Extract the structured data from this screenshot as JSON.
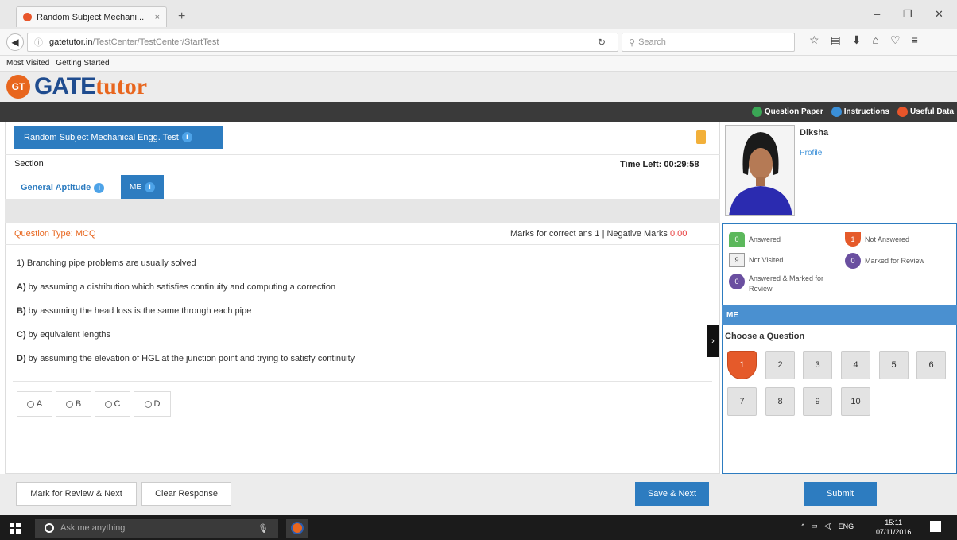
{
  "browser": {
    "tab_title": "Random Subject Mechani...",
    "tab_close": "×",
    "new_tab": "+",
    "win_min": "–",
    "win_max": "❐",
    "win_close": "✕",
    "url_domain": "gatetutor.in",
    "url_path": "/TestCenter/TestCenter/StartTest",
    "search_placeholder": "Search",
    "bookmarks": [
      "Most Visited",
      "Getting Started"
    ]
  },
  "header": {
    "logo_badge": "GT",
    "logo_gate": "GATE",
    "logo_tutor": "tutor",
    "links": [
      {
        "label": "Question Paper",
        "color": "#3aa655"
      },
      {
        "label": "Instructions",
        "color": "#3a8fd8"
      },
      {
        "label": "Useful Data",
        "color": "#e8552a"
      }
    ]
  },
  "test": {
    "title": "Random Subject Mechanical Engg. Test",
    "section_label": "Section",
    "time_left": "Time Left: 00:29:58",
    "tabs": [
      {
        "label": "General Aptitude",
        "active": false
      },
      {
        "label": "ME",
        "active": true
      }
    ]
  },
  "question": {
    "type_label": "Question Type: MCQ",
    "marks_prefix": "Marks for correct ans",
    "marks_correct": "1",
    "marks_sep": "| Negative Marks",
    "marks_negative": "0.00",
    "text": "1) Branching pipe problems are usually solved",
    "options": [
      {
        "key": "A)",
        "text": "by assuming a distribution which satisfies continuity and computing a correction"
      },
      {
        "key": "B)",
        "text": "by assuming the head loss is the same through each pipe"
      },
      {
        "key": "C)",
        "text": "by equivalent lengths"
      },
      {
        "key": "D)",
        "text": "by assuming the elevation of HGL at the junction point and trying to satisfy continuity"
      }
    ],
    "choices": [
      "A",
      "B",
      "C",
      "D"
    ]
  },
  "actions": {
    "mark_review": "Mark for Review & Next",
    "clear": "Clear Response",
    "save_next": "Save & Next",
    "submit": "Submit"
  },
  "candidate": {
    "name": "Diksha",
    "profile_link": "Profile"
  },
  "legend": {
    "answered": {
      "count": "0",
      "label": "Answered",
      "color": "#5cb85c"
    },
    "not_answered": {
      "count": "1",
      "label": "Not Answered",
      "color": "#e55a2a"
    },
    "not_visited": {
      "count": "9",
      "label": "Not Visited"
    },
    "marked": {
      "count": "0",
      "label": "Marked for Review",
      "color": "#6a4fa0"
    },
    "answered_marked": {
      "count": "0",
      "label": "Answered & Marked for Review",
      "color": "#6a4fa0"
    }
  },
  "palette": {
    "section": "ME",
    "title": "Choose a Question",
    "questions": [
      "1",
      "2",
      "3",
      "4",
      "5",
      "6",
      "7",
      "8",
      "9",
      "10"
    ],
    "current": "1"
  },
  "taskbar": {
    "search_placeholder": "Ask me anything",
    "lang": "ENG",
    "time": "15:11",
    "date": "07/11/2016"
  }
}
